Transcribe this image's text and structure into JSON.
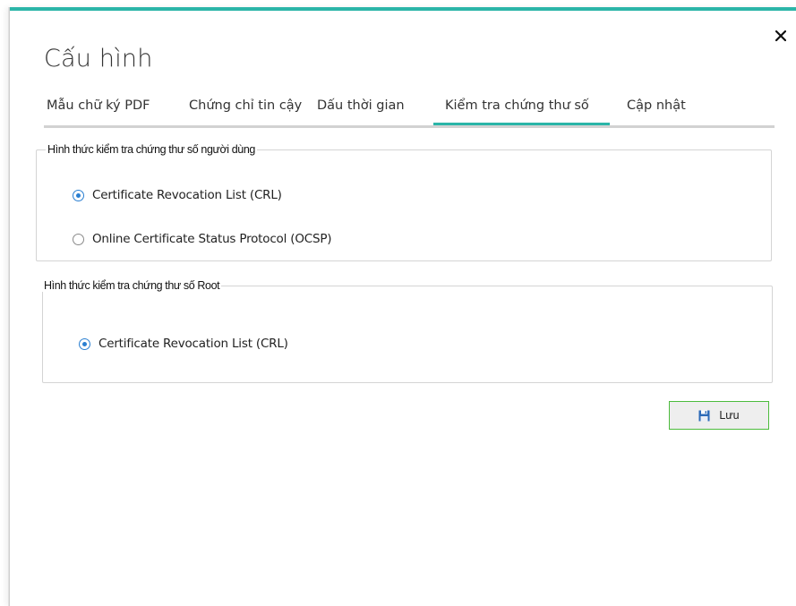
{
  "window": {
    "title": "Cấu hình",
    "accent_color": "#2bb5a8",
    "close_icon": "close-icon"
  },
  "tabs": [
    {
      "label": "Mẫu chữ ký PDF",
      "active": false
    },
    {
      "label": "Chứng chỉ tin cậy",
      "active": false
    },
    {
      "label": "Dấu thời gian",
      "active": false
    },
    {
      "label": "Kiểm tra chứng thư số",
      "active": true
    },
    {
      "label": "Cập nhật",
      "active": false
    }
  ],
  "user_cert_group": {
    "legend": "Hình thức kiểm tra chứng thư số người dùng",
    "options": [
      {
        "label": "Certificate Revocation List (CRL)",
        "checked": true
      },
      {
        "label": "Online Certificate Status Protocol (OCSP)",
        "checked": false
      }
    ]
  },
  "root_cert_group": {
    "legend": "Hình thức kiểm tra chứng thư số Root",
    "options": [
      {
        "label": "Certificate Revocation List (CRL)",
        "checked": true
      }
    ]
  },
  "save_button": {
    "label": "Lưu",
    "icon": "save-icon",
    "border_color": "#4cbb3c"
  },
  "colors": {
    "accent": "#2bb5a8",
    "radio_checked": "#2a7fd1"
  }
}
